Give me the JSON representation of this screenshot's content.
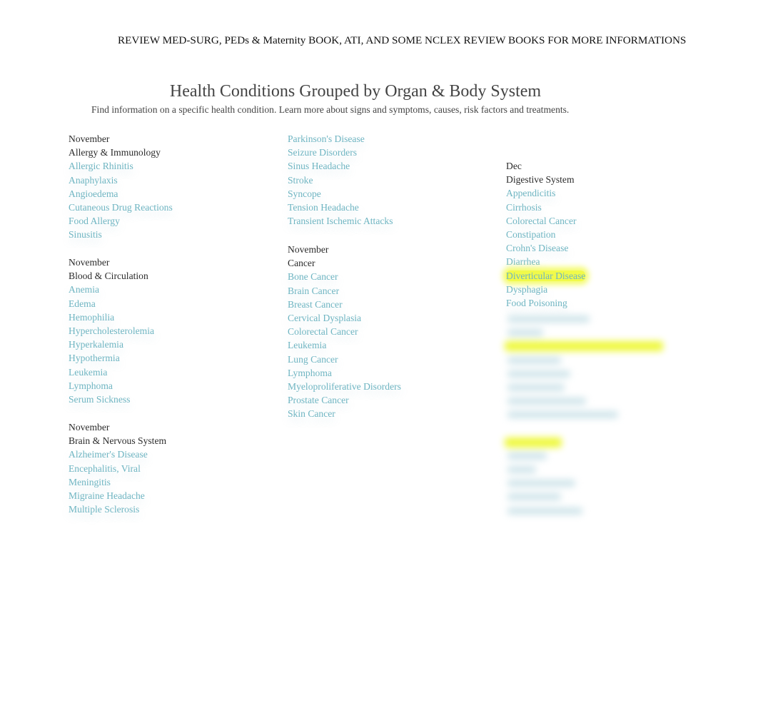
{
  "banner": "REVIEW MED-SURG, PEDs & Maternity BOOK, ATI, AND SOME NCLEX REVIEW BOOKS FOR MORE INFORMATIONS",
  "header": {
    "title": "Health Conditions Grouped by Organ & Body System",
    "subtitle": "Find information on a specific health condition. Learn more about signs and symptoms, causes, risk factors and treatments."
  },
  "colors": {
    "link": "#6fb5c2",
    "text": "#2b2b2b",
    "highlight": "#f1fa4a"
  },
  "groups": {
    "allergy": {
      "date": "November",
      "title": "Allergy & Immunology",
      "items": [
        "Allergic Rhinitis",
        "Anaphylaxis",
        "Angioedema",
        "Cutaneous Drug Reactions",
        "Food Allergy",
        "Sinusitis"
      ]
    },
    "blood": {
      "date": "November",
      "title": "Blood & Circulation",
      "items": [
        "Anemia",
        "Edema",
        "Hemophilia",
        "Hypercholesterolemia",
        "Hyperkalemia",
        "Hypothermia",
        "Leukemia",
        "Lymphoma",
        "Serum Sickness"
      ]
    },
    "brain": {
      "date": "November",
      "title": "Brain & Nervous System",
      "items": [
        "Alzheimer's Disease",
        "Encephalitis, Viral",
        "Meningitis",
        "Migraine Headache",
        "Multiple Sclerosis"
      ],
      "continued_items": [
        "Parkinson's Disease",
        "Seizure Disorders",
        "Sinus Headache",
        "Stroke",
        "Syncope",
        "Tension Headache",
        "Transient Ischemic Attacks"
      ]
    },
    "cancer": {
      "date": "November",
      "title": "Cancer",
      "items": [
        "Bone Cancer",
        "Brain Cancer",
        "Breast Cancer",
        "Cervical Dysplasia",
        "Colorectal Cancer",
        "Leukemia",
        "Lung Cancer",
        "Lymphoma",
        "Myeloproliferative Disorders",
        "Prostate Cancer",
        "Skin Cancer"
      ]
    },
    "digestive": {
      "date": "Dec",
      "title": "Digestive System",
      "items": [
        "Appendicitis",
        "Cirrhosis",
        "Colorectal Cancer",
        "Constipation",
        "Crohn's Disease",
        "Diarrhea",
        "Diverticular Disease",
        "Dysphagia",
        "Food Poisoning"
      ],
      "highlighted_item": "Diverticular Disease"
    }
  }
}
